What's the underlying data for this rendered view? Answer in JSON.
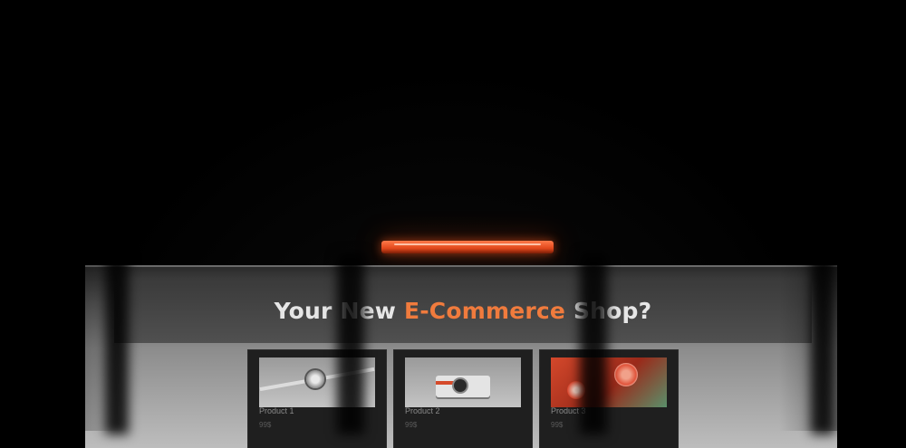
{
  "hero": {
    "title_part1": "Your New ",
    "title_accent": "E-Commerce",
    "title_part2": " Shop?"
  },
  "products": [
    {
      "name": "Product 1",
      "price": "99$",
      "icon": "watch-icon"
    },
    {
      "name": "Product 2",
      "price": "99$",
      "icon": "camera-icon"
    },
    {
      "name": "Product 3",
      "price": "99$",
      "icon": "grapefruit-icon"
    }
  ],
  "colors": {
    "accent": "#f07b3d",
    "glow": "#e2481c",
    "background": "#000000"
  }
}
